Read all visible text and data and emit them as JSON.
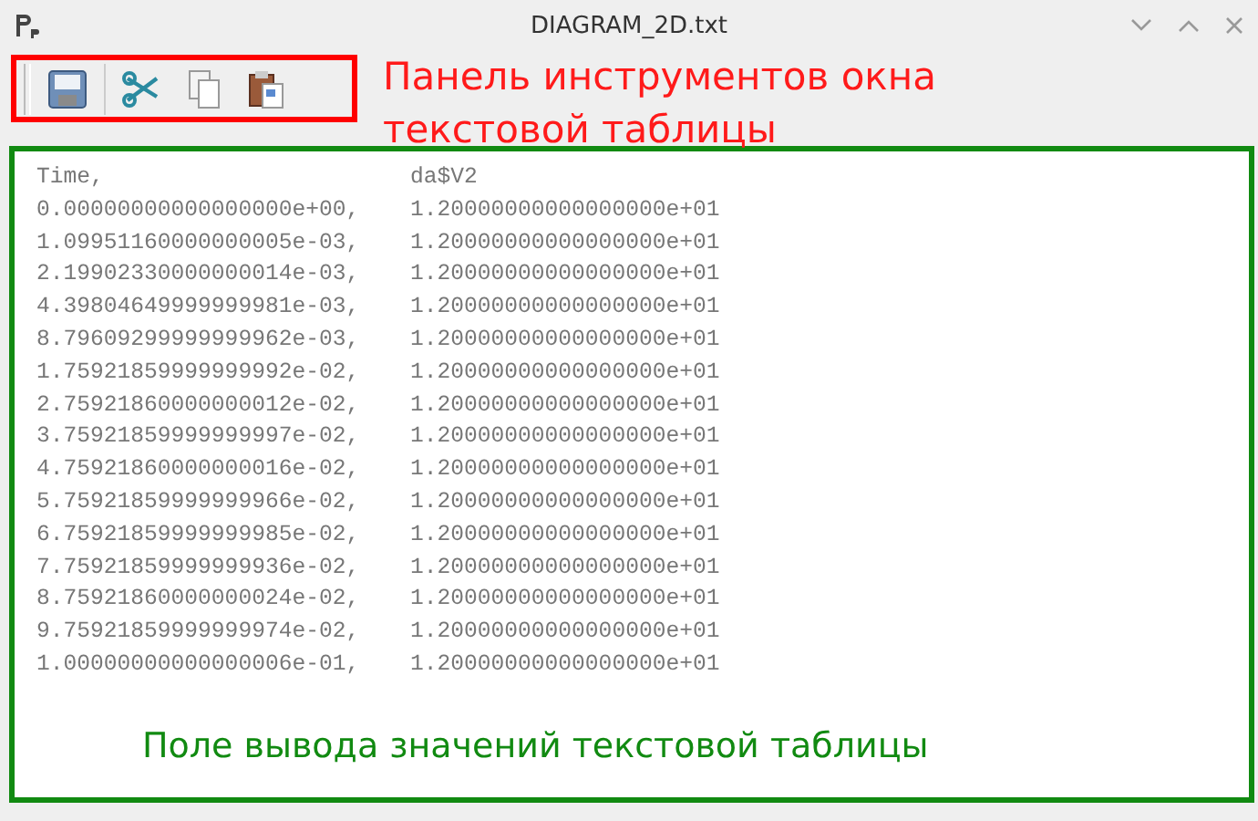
{
  "window": {
    "title": "DIAGRAM_2D.txt"
  },
  "toolbar": {
    "buttons": [
      {
        "kind": "save"
      },
      {
        "kind": "cut"
      },
      {
        "kind": "copy"
      },
      {
        "kind": "paste"
      }
    ],
    "annotation": "Панель инструментов окна текстовой таблицы"
  },
  "table": {
    "columns": [
      "Time,",
      "da$V2"
    ],
    "rows": [
      [
        "0.00000000000000000e+00,",
        "1.20000000000000000e+01"
      ],
      [
        "1.09951160000000005e-03,",
        "1.20000000000000000e+01"
      ],
      [
        "2.19902330000000014e-03,",
        "1.20000000000000000e+01"
      ],
      [
        "4.39804649999999981e-03,",
        "1.20000000000000000e+01"
      ],
      [
        "8.79609299999999962e-03,",
        "1.20000000000000000e+01"
      ],
      [
        "1.75921859999999992e-02,",
        "1.20000000000000000e+01"
      ],
      [
        "2.75921860000000012e-02,",
        "1.20000000000000000e+01"
      ],
      [
        "3.75921859999999997e-02,",
        "1.20000000000000000e+01"
      ],
      [
        "4.75921860000000016e-02,",
        "1.20000000000000000e+01"
      ],
      [
        "5.75921859999999966e-02,",
        "1.20000000000000000e+01"
      ],
      [
        "6.75921859999999985e-02,",
        "1.20000000000000000e+01"
      ],
      [
        "7.75921859999999936e-02,",
        "1.20000000000000000e+01"
      ],
      [
        "8.75921860000000024e-02,",
        "1.20000000000000000e+01"
      ],
      [
        "9.75921859999999974e-02,",
        "1.20000000000000000e+01"
      ],
      [
        "1.00000000000000006e-01,",
        "1.20000000000000000e+01"
      ]
    ],
    "annotation": "Поле вывода значений текстовой таблицы"
  }
}
